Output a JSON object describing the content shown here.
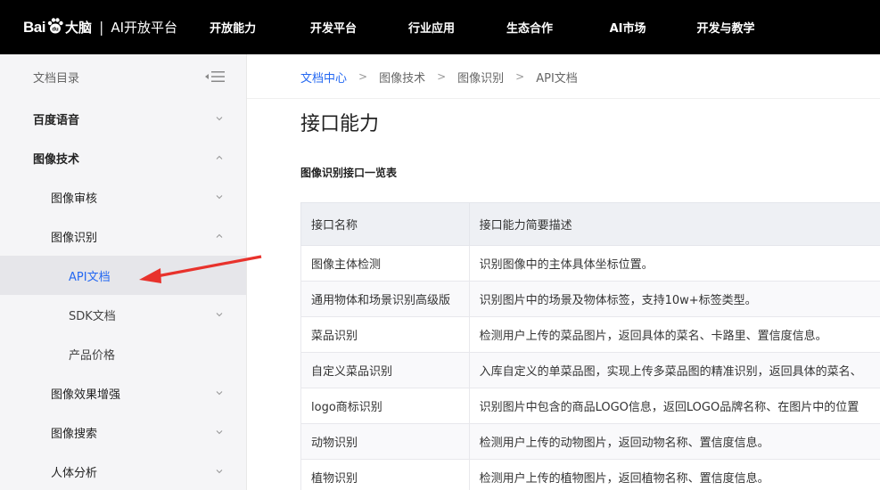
{
  "header": {
    "logo_bai": "Bai",
    "logo_du": "大脑",
    "logo_sep": "|",
    "logo_platform": "AI开放平台",
    "nav": [
      "开放能力",
      "开发平台",
      "行业应用",
      "生态合作",
      "AI市场",
      "开发与教学"
    ]
  },
  "sidebar": {
    "title": "文档目录",
    "items": [
      {
        "label": "百度语音",
        "level": 1,
        "chevron": "down"
      },
      {
        "label": "图像技术",
        "level": 1,
        "chevron": "up"
      },
      {
        "label": "图像审核",
        "level": 2,
        "chevron": "down"
      },
      {
        "label": "图像识别",
        "level": 2,
        "chevron": "up"
      },
      {
        "label": "API文档",
        "level": 3,
        "chevron": "none",
        "active": true
      },
      {
        "label": "SDK文档",
        "level": 3,
        "chevron": "down"
      },
      {
        "label": "产品价格",
        "level": 3,
        "chevron": "none"
      },
      {
        "label": "图像效果增强",
        "level": 2,
        "chevron": "down"
      },
      {
        "label": "图像搜索",
        "level": 2,
        "chevron": "down"
      },
      {
        "label": "人体分析",
        "level": 2,
        "chevron": "down"
      }
    ]
  },
  "breadcrumb": [
    "文档中心",
    "图像技术",
    "图像识别",
    "API文档"
  ],
  "breadcrumb_sep": ">",
  "content": {
    "title": "接口能力",
    "subtitle": "图像识别接口一览表",
    "table": {
      "headers": [
        "接口名称",
        "接口能力简要描述"
      ],
      "rows": [
        [
          "图像主体检测",
          "识别图像中的主体具体坐标位置。"
        ],
        [
          "通用物体和场景识别高级版",
          "识别图片中的场景及物体标签，支持10w+标签类型。"
        ],
        [
          "菜品识别",
          "检测用户上传的菜品图片，返回具体的菜名、卡路里、置信度信息。"
        ],
        [
          "自定义菜品识别",
          "入库自定义的单菜品图，实现上传多菜品图的精准识别，返回具体的菜名、"
        ],
        [
          "logo商标识别",
          "识别图片中包含的商品LOGO信息，返回LOGO品牌名称、在图片中的位置"
        ],
        [
          "动物识别",
          "检测用户上传的动物图片，返回动物名称、置信度信息。"
        ],
        [
          "植物识别",
          "检测用户上传的植物图片，返回植物名称、置信度信息。"
        ]
      ]
    }
  },
  "colors": {
    "accent": "#2468f2",
    "topbar": "#000000",
    "sidebar_bg": "#f5f5f7",
    "annotation_arrow": "#e8322c"
  }
}
